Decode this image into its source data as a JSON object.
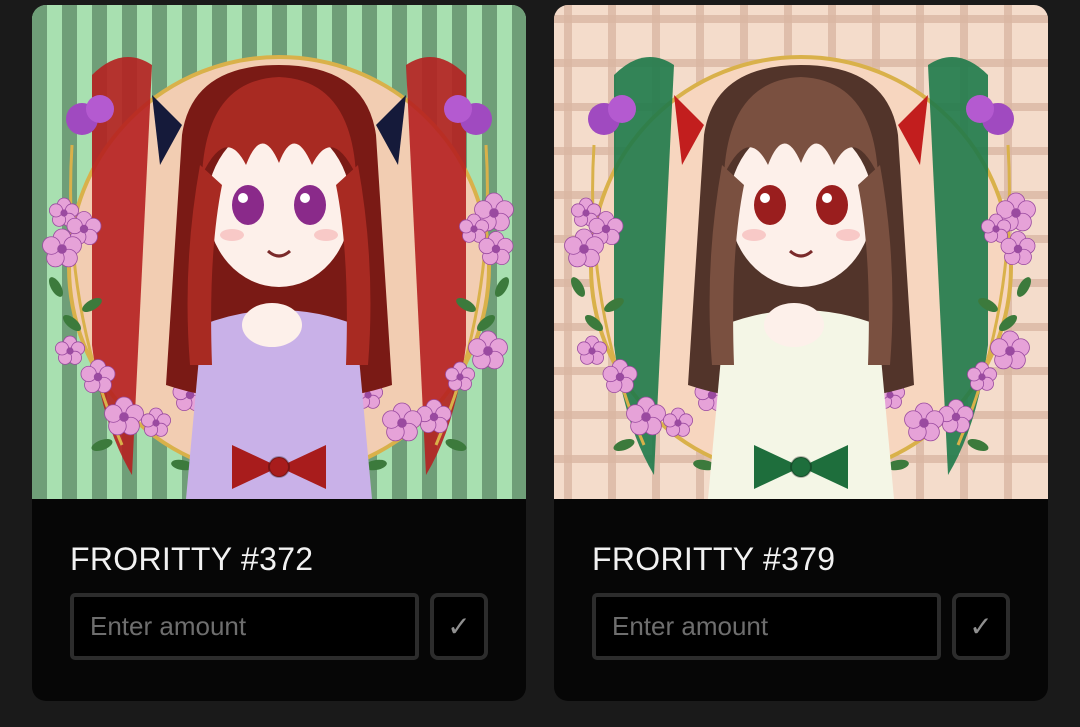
{
  "cards": [
    {
      "title": "FRORITTY #372",
      "amount_placeholder": "Enter amount",
      "confirm_icon": "✓",
      "art": {
        "stripe_a": "#a8e0b0",
        "stripe_b": "#6f9e78",
        "medallion": "#f2cdb2",
        "ribbon": "#b52020",
        "hair": "#a82a22",
        "hair_shadow": "#7a1a15",
        "bow": "#151a3a",
        "eyes": "#8a2a8a",
        "outfit": "#c9b1e8",
        "front_bow": "#a81c1c",
        "flower": "#e6a2d8",
        "flower_dark": "#9a4aa0",
        "leaf": "#3c7a3c",
        "frame": "#d9b14a"
      }
    },
    {
      "title": "FRORITTY #379",
      "amount_placeholder": "Enter amount",
      "confirm_icon": "✓",
      "art": {
        "stripe_a": "#f4dccb",
        "stripe_b": "#d9b7a2",
        "medallion": "#f7d6bf",
        "ribbon": "#1e7a4a",
        "hair": "#7a5040",
        "hair_shadow": "#52342a",
        "bow": "#c21e1e",
        "eyes": "#9a1e1e",
        "outfit": "#f4f6e6",
        "front_bow": "#1e6e3c",
        "flower": "#e6a2d8",
        "flower_dark": "#9a4aa0",
        "leaf": "#3c7a3c",
        "frame": "#d9b14a"
      }
    }
  ]
}
